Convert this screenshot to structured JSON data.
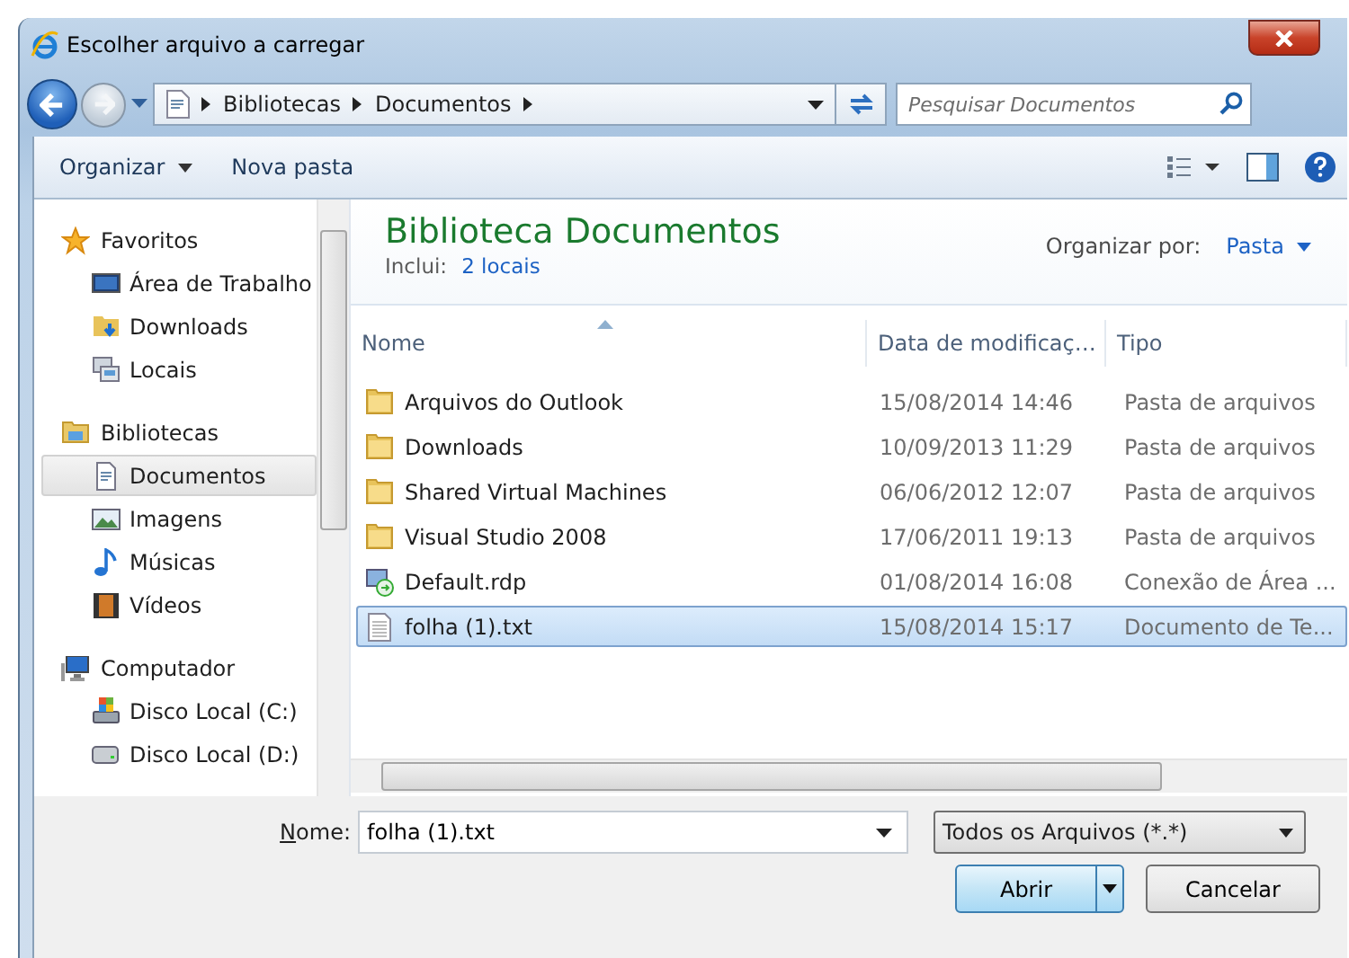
{
  "window": {
    "title": "Escolher arquivo a carregar"
  },
  "address_bar": {
    "crumbs": [
      "Bibliotecas",
      "Documentos"
    ]
  },
  "search": {
    "placeholder": "Pesquisar Documentos"
  },
  "toolbar": {
    "items": [
      {
        "label": "Organizar",
        "dropdown": true
      },
      {
        "label": "Nova pasta",
        "dropdown": false
      }
    ]
  },
  "sidebar": {
    "groups": [
      {
        "label": "Favoritos",
        "items": [
          {
            "label": "Área de Trabalho",
            "selected": false
          },
          {
            "label": "Downloads",
            "selected": false
          },
          {
            "label": "Locais",
            "selected": false
          }
        ]
      },
      {
        "label": "Bibliotecas",
        "items": [
          {
            "label": "Documentos",
            "selected": true
          },
          {
            "label": "Imagens",
            "selected": false
          },
          {
            "label": "Músicas",
            "selected": false
          },
          {
            "label": "Vídeos",
            "selected": false
          }
        ]
      },
      {
        "label": "Computador",
        "items": [
          {
            "label": "Disco Local (C:)",
            "selected": false
          },
          {
            "label": "Disco Local (D:)",
            "selected": false
          }
        ]
      }
    ]
  },
  "library": {
    "title": "Biblioteca Documentos",
    "includes_label": "Inclui:",
    "includes_link": "2 locais",
    "arrange_label": "Organizar por:",
    "arrange_value": "Pasta"
  },
  "table": {
    "columns": [
      {
        "label": "Nome",
        "sorted": true
      },
      {
        "label": "Data de modificaç…",
        "sorted": false
      },
      {
        "label": "Tipo",
        "sorted": false
      }
    ],
    "rows": [
      {
        "name": "Arquivos do Outlook",
        "date": "15/08/2014 14:46",
        "type": "Pasta de arquivos",
        "kind": "folder",
        "selected": false
      },
      {
        "name": "Downloads",
        "date": "10/09/2013 11:29",
        "type": "Pasta de arquivos",
        "kind": "folder",
        "selected": false
      },
      {
        "name": "Shared Virtual Machines",
        "date": "06/06/2012 12:07",
        "type": "Pasta de arquivos",
        "kind": "folder",
        "selected": false
      },
      {
        "name": "Visual Studio 2008",
        "date": "17/06/2011 19:13",
        "type": "Pasta de arquivos",
        "kind": "folder",
        "selected": false
      },
      {
        "name": "Default.rdp",
        "date": "01/08/2014 16:08",
        "type": "Conexão de Área ...",
        "kind": "shortcut",
        "selected": false
      },
      {
        "name": "folha (1).txt",
        "date": "15/08/2014 15:17",
        "type": "Documento de Te...",
        "kind": "text",
        "selected": true
      }
    ]
  },
  "footer": {
    "name_label": "Nome:",
    "name_value": "folha (1).txt",
    "filter": "Todos os Arquivos (*.*)",
    "buttons": [
      {
        "label": "Abrir",
        "kind": "split",
        "default": true
      },
      {
        "label": "Cancelar",
        "kind": "plain",
        "default": false
      }
    ]
  }
}
